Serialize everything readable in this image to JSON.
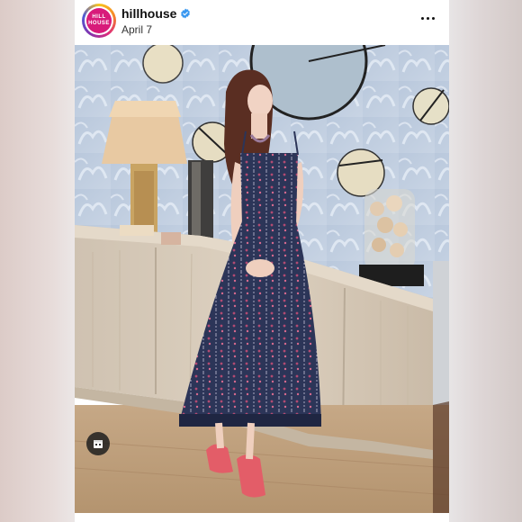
{
  "post": {
    "username": "hillhouse",
    "date": "April 7",
    "avatar_text": [
      "HILL",
      "HOUSE"
    ],
    "verified": true
  },
  "icons": {
    "verified": "verified-badge-icon",
    "more": "more-options-icon",
    "tag": "user-tag-icon"
  },
  "colors": {
    "verified_blue": "#3897f0",
    "brand_pink": "#d81b7a"
  }
}
